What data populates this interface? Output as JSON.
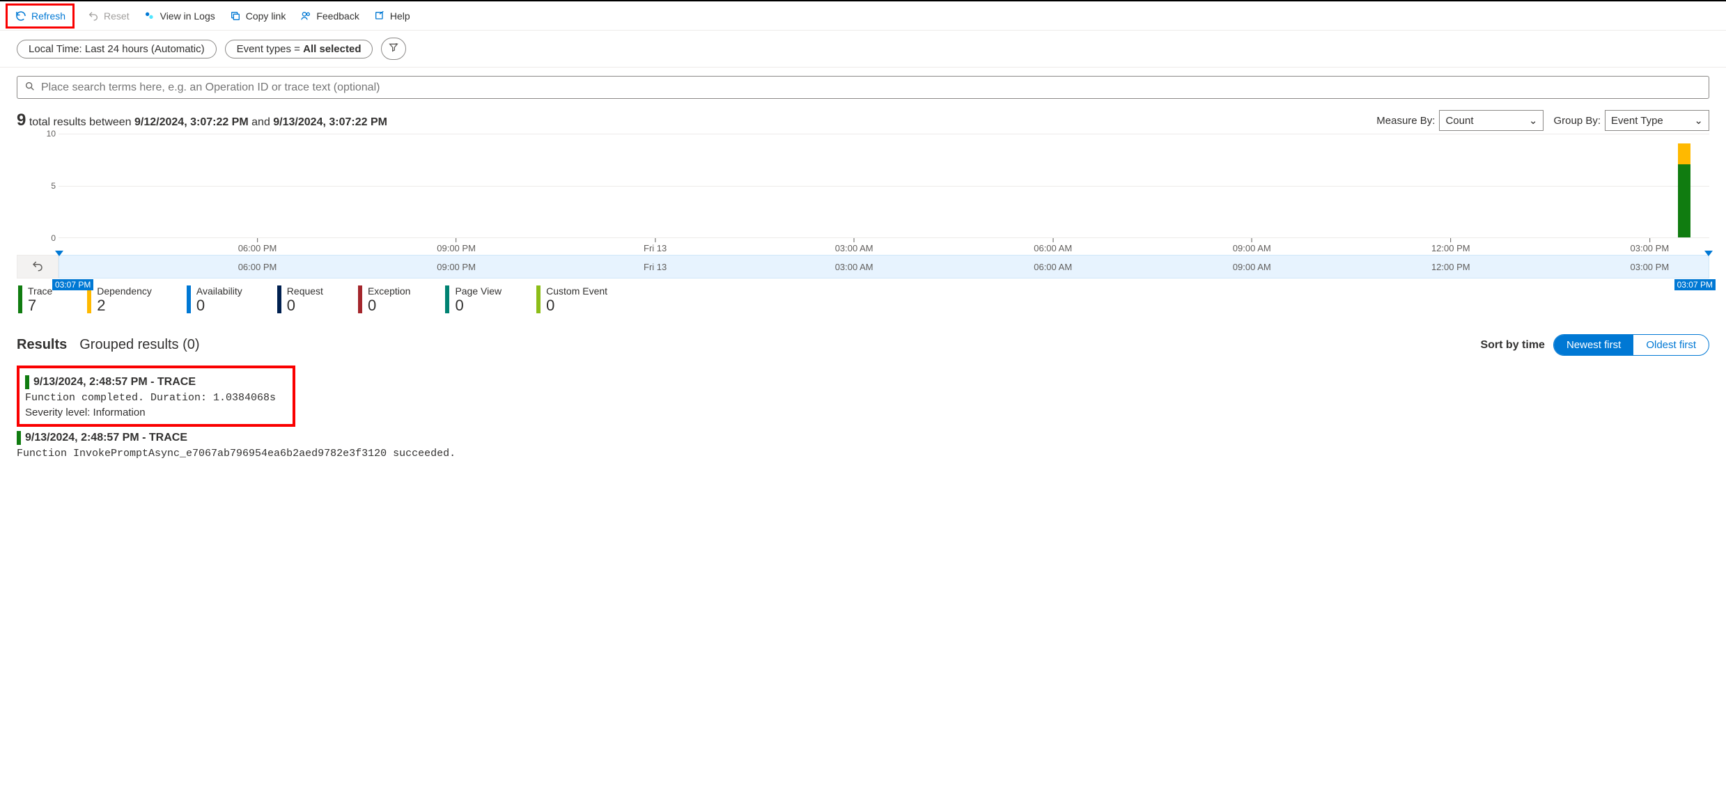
{
  "toolbar": {
    "refresh": "Refresh",
    "reset": "Reset",
    "view_logs": "View in Logs",
    "copy_link": "Copy link",
    "feedback": "Feedback",
    "help": "Help"
  },
  "filters": {
    "time_pill": "Local Time: Last 24 hours (Automatic)",
    "event_pill_prefix": "Event types = ",
    "event_pill_value": "All selected"
  },
  "search_placeholder": "Place search terms here, e.g. an Operation ID or trace text (optional)",
  "summary": {
    "count": "9",
    "text1": " total results between ",
    "from": "9/12/2024, 3:07:22 PM",
    "text2": " and ",
    "to": "9/13/2024, 3:07:22 PM"
  },
  "measure_by": {
    "label": "Measure By:",
    "value": "Count"
  },
  "group_by": {
    "label": "Group By:",
    "value": "Event Type"
  },
  "chart_data": {
    "type": "bar",
    "ylabel": "",
    "ylim": [
      0,
      10
    ],
    "y_ticks": [
      0,
      5,
      10
    ],
    "x_ticks": [
      "06:00 PM",
      "09:00 PM",
      "Fri 13",
      "03:00 AM",
      "06:00 AM",
      "09:00 AM",
      "12:00 PM",
      "03:00 PM"
    ],
    "series": [
      {
        "name": "Trace",
        "color": "#107c10"
      },
      {
        "name": "Dependency",
        "color": "#ffb900"
      }
    ],
    "stacks": [
      {
        "x_percent": 98.5,
        "segments": [
          {
            "series": "Trace",
            "value": 7
          },
          {
            "series": "Dependency",
            "value": 2
          }
        ]
      }
    ]
  },
  "brush": {
    "start": "03:07 PM",
    "end": "03:07 PM"
  },
  "legend": [
    {
      "label": "Trace",
      "count": "7",
      "color": "#107c10"
    },
    {
      "label": "Dependency",
      "count": "2",
      "color": "#ffb900"
    },
    {
      "label": "Availability",
      "count": "0",
      "color": "#0078d4"
    },
    {
      "label": "Request",
      "count": "0",
      "color": "#002050"
    },
    {
      "label": "Exception",
      "count": "0",
      "color": "#a4262c"
    },
    {
      "label": "Page View",
      "count": "0",
      "color": "#008272"
    },
    {
      "label": "Custom Event",
      "count": "0",
      "color": "#8cbd18"
    }
  ],
  "tabs": {
    "results": "Results",
    "grouped": "Grouped results (0)"
  },
  "sort": {
    "label": "Sort by time",
    "newest": "Newest first",
    "oldest": "Oldest first"
  },
  "results": [
    {
      "timestamp": "9/13/2024, 2:48:57 PM",
      "type": "TRACE",
      "message": "Function completed. Duration: 1.0384068s",
      "severity": "Severity level: Information"
    },
    {
      "timestamp": "9/13/2024, 2:48:57 PM",
      "type": "TRACE",
      "message": "Function InvokePromptAsync_e7067ab796954ea6b2aed9782e3f3120 succeeded."
    }
  ]
}
